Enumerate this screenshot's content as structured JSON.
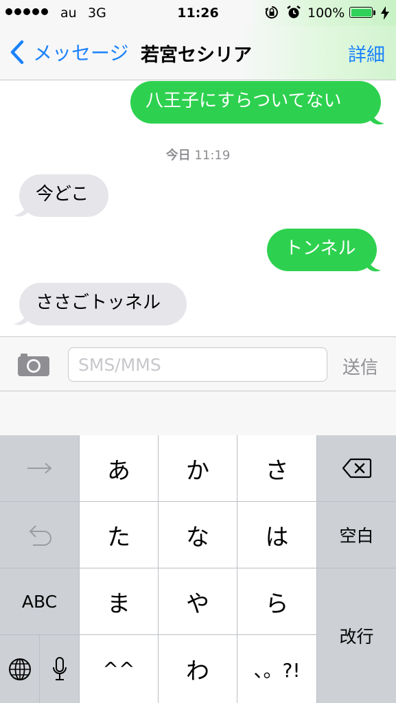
{
  "status_bar": {
    "carrier": "au",
    "network": "3G",
    "time": "11:26",
    "battery_percent": "100%",
    "battery_level": 1.0,
    "signal_dots": 5,
    "icons": [
      "rotation-lock-icon",
      "alarm-icon",
      "battery-icon",
      "charging-icon"
    ]
  },
  "nav": {
    "back_label": "メッセージ",
    "title": "若宮セシリア",
    "detail_label": "詳細"
  },
  "conversation": {
    "timestamp_day": "今日",
    "timestamp_time": "11:19",
    "messages": [
      {
        "direction": "outgoing",
        "text": "八王子にすらついてない"
      },
      {
        "direction": "incoming",
        "text": "今どこ"
      },
      {
        "direction": "outgoing",
        "text": "トンネル"
      },
      {
        "direction": "incoming",
        "text": "ささごトッネル"
      }
    ]
  },
  "input_bar": {
    "placeholder": "SMS/MMS",
    "value": "",
    "send_label": "送信"
  },
  "keyboard": {
    "row1": [
      "→",
      "あ",
      "か",
      "さ"
    ],
    "row2": [
      "た",
      "な",
      "は"
    ],
    "space_label": "空白",
    "row3": [
      "ABC",
      "ま",
      "や",
      "ら"
    ],
    "return_label": "改行",
    "row4": [
      "^^",
      "わ",
      "、。?!"
    ],
    "icons": [
      "arrow-right-icon",
      "backspace-icon",
      "undo-icon",
      "globe-icon",
      "microphone-icon"
    ]
  },
  "colors": {
    "accent": "#1a82fb",
    "outgoing_bubble": "#2ed14f",
    "incoming_bubble": "#e5e5ea"
  }
}
